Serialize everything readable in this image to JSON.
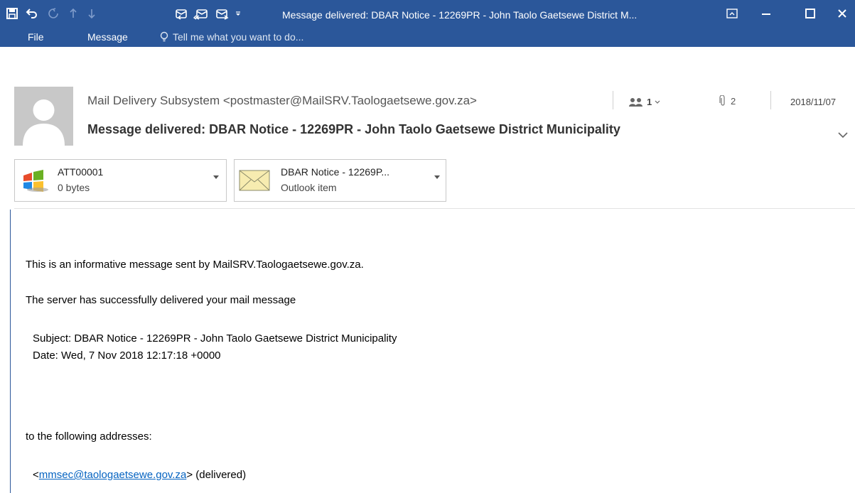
{
  "window": {
    "title": "Message delivered: DBAR Notice - 12269PR - John Taolo Gaetsewe District M...",
    "accent_color": "#2b579a"
  },
  "quick_access": [
    "save-icon",
    "undo-icon",
    "redo-icon",
    "up-arrow-icon",
    "down-arrow-icon",
    "reply-icon",
    "reply-all-icon",
    "forward-icon",
    "customize-qat-icon"
  ],
  "menu": {
    "file": "File",
    "message": "Message",
    "tell_me": "Tell me what you want to do..."
  },
  "header": {
    "sender": "Mail Delivery Subsystem <postmaster@MailSRV.Taologaetsewe.gov.za>",
    "recipients": "1",
    "attachment_count": "2",
    "date": "2018/11/07",
    "subject": "Message delivered: DBAR Notice - 12269PR - John Taolo Gaetsewe District Municipality"
  },
  "attachments": [
    {
      "name": "ATT00001",
      "meta": "0 bytes",
      "icon": "windows-file-icon"
    },
    {
      "name": "DBAR Notice - 12269P...",
      "meta": "Outlook item",
      "icon": "envelope-icon"
    }
  ],
  "body": {
    "line1": "This is an informative message sent by MailSRV.Taologaetsewe.gov.za.",
    "line2": "The server has successfully delivered your mail message",
    "subject_line": "Subject: DBAR Notice - 12269PR - John Taolo Gaetsewe District Municipality",
    "date_line": "Date: Wed, 7 Nov 2018 12:17:18 +0000",
    "to_line": "to the following addresses:",
    "addr_open": "<",
    "address": "mmsec@taologaetsewe.gov.za",
    "addr_close": "> (delivered)"
  }
}
